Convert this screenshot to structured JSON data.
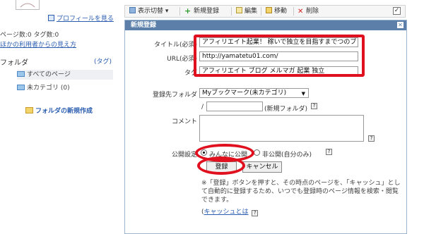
{
  "sidebar": {
    "profile_link": "プロフィールを見る",
    "stats": "ページ数:0 タグ数:0",
    "other_view_link": "ほかの利用者からの見え方",
    "folder_heading": "フォルダ",
    "tag_link": "(タグ)",
    "folders": [
      {
        "label": "すべてのページ"
      },
      {
        "label": "未カテゴリ (0)"
      }
    ],
    "new_folder_link": "フォルダの新規作成"
  },
  "toolbar": {
    "display_switch": "表示切替",
    "new_register": "新規登録",
    "edit": "編集",
    "move": "移動",
    "delete": "削除"
  },
  "dialog": {
    "title": "新規登録",
    "title_label": "タイトル(必須)",
    "title_value": "アフィリエイト起業！ 稼いで独立を目指すまでつのブ",
    "url_label": "URL(必須)",
    "url_value": "http://yamatetu01.com/",
    "tag_label": "タグ",
    "tag_value": "アフィリエイト ブログ メルマガ 起業 独立",
    "folder_label": "登録先フォルダ",
    "folder_value": "Myブックマーク(未カテゴリ)",
    "new_folder_prefix": "/",
    "new_folder_hint": "(新規フォルダ)",
    "comment_label": "コメント",
    "visibility_label": "公開設定",
    "visibility_public": "みんなに公開",
    "visibility_private": "非公開(自分のみ)",
    "register_button": "登録",
    "cancel_button": "キャンセル",
    "note": "※「登録」ボタンを押すと、その時点のページを、「キャッシュ」として自動的に登録するため、いつでも登録時のページ情報を検索・閲覧できます。",
    "cache_link_prefix": "(",
    "cache_link": "キャッシュとは",
    "help_mark": "?"
  },
  "colors": {
    "title_bar": "#5b7fa9",
    "highlight": "#e0101e",
    "link": "#2a5db0"
  }
}
